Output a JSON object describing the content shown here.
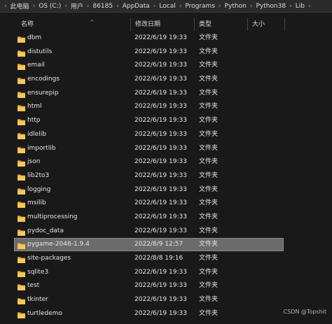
{
  "breadcrumb": [
    "此电脑",
    "OS (C:)",
    "用户",
    "86185",
    "AppData",
    "Local",
    "Programs",
    "Python",
    "Python38",
    "Lib"
  ],
  "header": {
    "name": "名称",
    "modified": "修改日期",
    "type": "类型",
    "size": "大小",
    "sort_indicator": "^"
  },
  "files": [
    {
      "name": "dbm",
      "modified": "2022/6/19 19:33",
      "type": "文件夹"
    },
    {
      "name": "distutils",
      "modified": "2022/6/19 19:33",
      "type": "文件夹"
    },
    {
      "name": "email",
      "modified": "2022/6/19 19:33",
      "type": "文件夹"
    },
    {
      "name": "encodings",
      "modified": "2022/6/19 19:33",
      "type": "文件夹"
    },
    {
      "name": "ensurepip",
      "modified": "2022/6/19 19:33",
      "type": "文件夹"
    },
    {
      "name": "html",
      "modified": "2022/6/19 19:33",
      "type": "文件夹"
    },
    {
      "name": "http",
      "modified": "2022/6/19 19:33",
      "type": "文件夹"
    },
    {
      "name": "idlelib",
      "modified": "2022/6/19 19:33",
      "type": "文件夹"
    },
    {
      "name": "importlib",
      "modified": "2022/6/19 19:33",
      "type": "文件夹"
    },
    {
      "name": "json",
      "modified": "2022/6/19 19:33",
      "type": "文件夹"
    },
    {
      "name": "lib2to3",
      "modified": "2022/6/19 19:33",
      "type": "文件夹"
    },
    {
      "name": "logging",
      "modified": "2022/6/19 19:33",
      "type": "文件夹"
    },
    {
      "name": "msilib",
      "modified": "2022/6/19 19:33",
      "type": "文件夹"
    },
    {
      "name": "multiprocessing",
      "modified": "2022/6/19 19:33",
      "type": "文件夹"
    },
    {
      "name": "pydoc_data",
      "modified": "2022/6/19 19:33",
      "type": "文件夹"
    },
    {
      "name": "pygame-2048-1.9.4",
      "modified": "2022/8/9 12:57",
      "type": "文件夹",
      "selected": true
    },
    {
      "name": "site-packages",
      "modified": "2022/8/8 19:16",
      "type": "文件夹"
    },
    {
      "name": "sqlite3",
      "modified": "2022/6/19 19:33",
      "type": "文件夹"
    },
    {
      "name": "test",
      "modified": "2022/6/19 19:33",
      "type": "文件夹"
    },
    {
      "name": "tkinter",
      "modified": "2022/6/19 19:33",
      "type": "文件夹"
    },
    {
      "name": "turtledemo",
      "modified": "2022/6/19 19:33",
      "type": "文件夹"
    }
  ],
  "icons": {
    "folder": "folder-icon",
    "chevron": "chevron-right-icon"
  },
  "colors": {
    "background": "#191919",
    "folder": "#e8b13a",
    "selection": "#6b6b6b"
  },
  "watermark": "CSDN @Topshit"
}
